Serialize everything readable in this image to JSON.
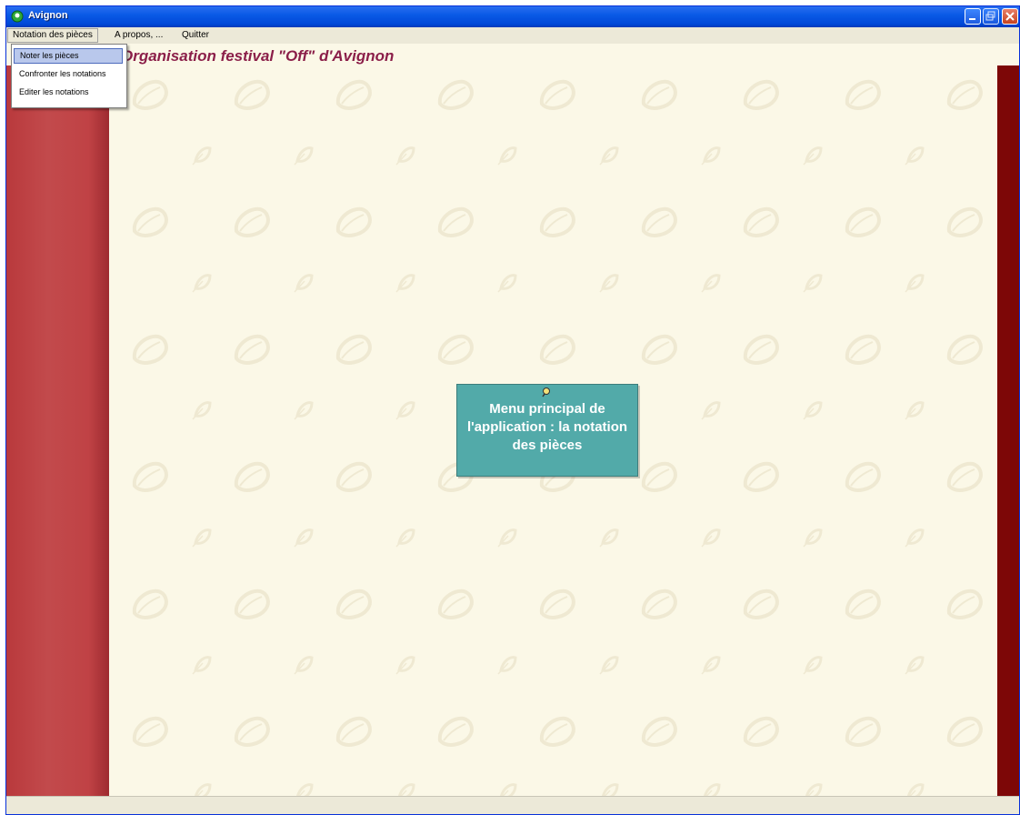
{
  "window": {
    "title": "Avignon"
  },
  "menubar": {
    "items": [
      {
        "label": "Notation des pièces"
      },
      {
        "label": "A propos, ..."
      },
      {
        "label": "Quitter"
      }
    ]
  },
  "dropdown": {
    "items": [
      {
        "label": "Noter les pièces",
        "highlighted": true
      },
      {
        "label": "Confronter les notations"
      },
      {
        "label": "Editer les notations"
      }
    ]
  },
  "header": {
    "title": "Organisation festival \"Off\" d'Avignon"
  },
  "note": {
    "text": "Menu principal de l'application : la notation des pièces"
  },
  "colors": {
    "titlebar": "#0a5ae6",
    "header_title": "#8b1f49",
    "left_band": "#c24a4c",
    "right_band": "#7d0707",
    "paper": "#fbf8e7",
    "note_box": "#52aaa9"
  }
}
